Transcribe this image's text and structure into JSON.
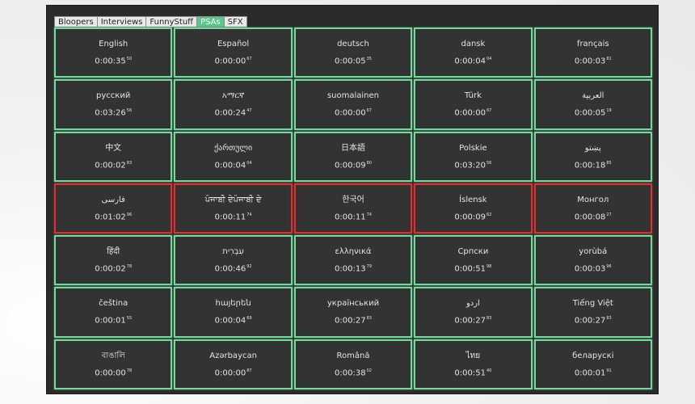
{
  "tabs": [
    {
      "label": "Bloopers",
      "active": false
    },
    {
      "label": "Interviews",
      "active": false
    },
    {
      "label": "FunnyStuff",
      "active": false
    },
    {
      "label": "PSAs",
      "active": true
    },
    {
      "label": "SFX",
      "active": false
    }
  ],
  "colors": {
    "cell_border": "#7fd3a0",
    "playing_border": "#c83a3a",
    "active_tab": "#5cc58a",
    "cell_bg": "#333333"
  },
  "clips": [
    {
      "lang": "English",
      "time": "0:00:35",
      "frames": "50",
      "playing": false
    },
    {
      "lang": "Español",
      "time": "0:00:00",
      "frames": "67",
      "playing": false
    },
    {
      "lang": "deutsch",
      "time": "0:00:05",
      "frames": "35",
      "playing": false
    },
    {
      "lang": "dansk",
      "time": "0:00:04",
      "frames": "04",
      "playing": false
    },
    {
      "lang": "français",
      "time": "0:00:03",
      "frames": "81",
      "playing": false
    },
    {
      "lang": "русский",
      "time": "0:03:26",
      "frames": "56",
      "playing": false
    },
    {
      "lang": "አማርኛ",
      "time": "0:00:24",
      "frames": "47",
      "playing": false
    },
    {
      "lang": "suomalainen",
      "time": "0:00:00",
      "frames": "67",
      "playing": false
    },
    {
      "lang": "Türk",
      "time": "0:00:00",
      "frames": "67",
      "playing": false
    },
    {
      "lang": "العربية",
      "time": "0:00:05",
      "frames": "19",
      "playing": false
    },
    {
      "lang": "中文",
      "time": "0:00:02",
      "frames": "83",
      "playing": false
    },
    {
      "lang": "ქართული",
      "time": "0:00:04",
      "frames": "04",
      "playing": false
    },
    {
      "lang": "日本語",
      "time": "0:00:09",
      "frames": "80",
      "playing": false
    },
    {
      "lang": "Polskie",
      "time": "0:03:20",
      "frames": "56",
      "playing": false
    },
    {
      "lang": "پښتو",
      "time": "0:00:18",
      "frames": "85",
      "playing": false
    },
    {
      "lang": "فارسی",
      "time": "0:01:02",
      "frames": "96",
      "playing": true
    },
    {
      "lang": "ਪੰਜਾਬੀ ਦੇਪੰਜਾਬੀ ਦੇ",
      "time": "0:00:11",
      "frames": "74",
      "playing": true
    },
    {
      "lang": "한국어",
      "time": "0:00:11",
      "frames": "74",
      "playing": true
    },
    {
      "lang": "Íslensk",
      "time": "0:00:09",
      "frames": "62",
      "playing": true
    },
    {
      "lang": "Монгол",
      "time": "0:00:08",
      "frames": "27",
      "playing": true
    },
    {
      "lang": "हिंदी",
      "time": "0:00:02",
      "frames": "78",
      "playing": false
    },
    {
      "lang": "עִבְרִית",
      "time": "0:00:46",
      "frames": "92",
      "playing": false
    },
    {
      "lang": "ελληνικά",
      "time": "0:00:13",
      "frames": "79",
      "playing": false
    },
    {
      "lang": "Српски",
      "time": "0:00:51",
      "frames": "98",
      "playing": false
    },
    {
      "lang": "yorùbá",
      "time": "0:00:03",
      "frames": "96",
      "playing": false
    },
    {
      "lang": "čeština",
      "time": "0:00:01",
      "frames": "55",
      "playing": false
    },
    {
      "lang": "հայերեն",
      "time": "0:00:04",
      "frames": "69",
      "playing": false
    },
    {
      "lang": "український",
      "time": "0:00:27",
      "frames": "83",
      "playing": false
    },
    {
      "lang": "اردو",
      "time": "0:00:27",
      "frames": "83",
      "playing": false
    },
    {
      "lang": "Tiếng Việt",
      "time": "0:00:27",
      "frames": "83",
      "playing": false
    },
    {
      "lang": "বাঙালি",
      "time": "0:00:00",
      "frames": "78",
      "playing": false
    },
    {
      "lang": "Azərbaycan",
      "time": "0:00:00",
      "frames": "87",
      "playing": false
    },
    {
      "lang": "Română",
      "time": "0:00:38",
      "frames": "02",
      "playing": false
    },
    {
      "lang": "ไทย",
      "time": "0:00:51",
      "frames": "40",
      "playing": false
    },
    {
      "lang": "беларускі",
      "time": "0:00:01",
      "frames": "91",
      "playing": false
    }
  ]
}
